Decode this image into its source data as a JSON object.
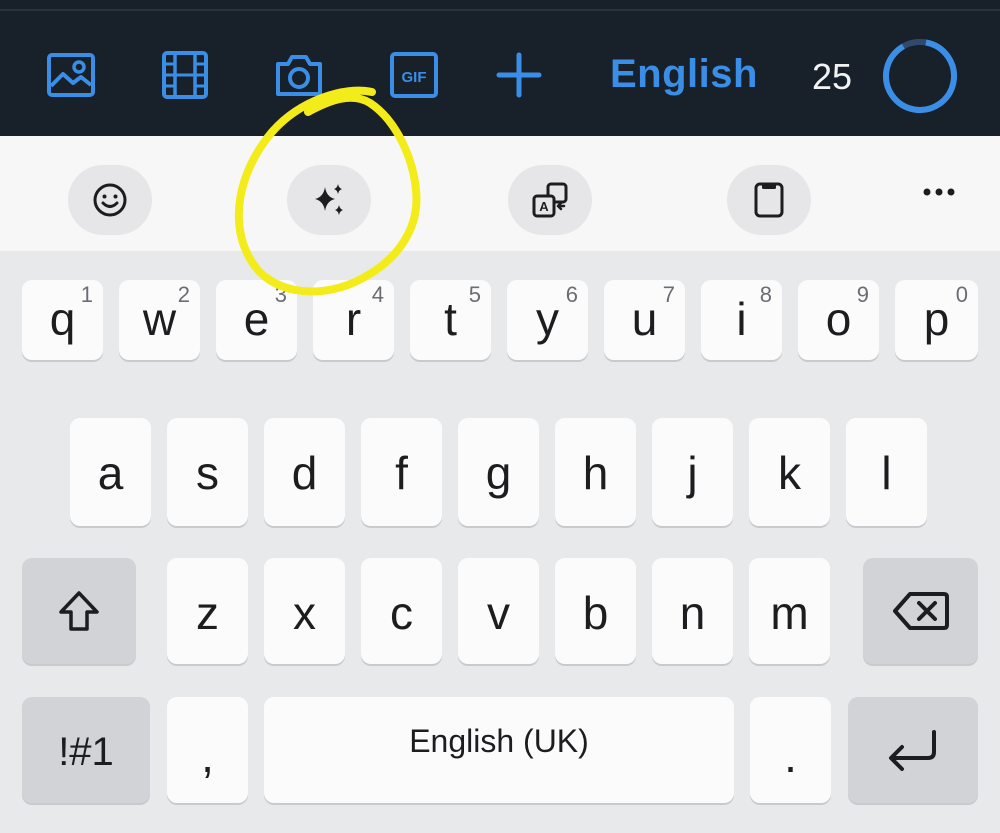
{
  "top_bar": {
    "icons": [
      "image-icon",
      "film-icon",
      "camera-icon",
      "gif-icon",
      "plus-icon"
    ],
    "gif_label": "GIF",
    "language_label": "English",
    "char_count": "25",
    "accent_color": "#3a8ee6"
  },
  "toolbar": {
    "icons": [
      "emoji-icon",
      "sparkles-icon",
      "translate-icon",
      "clipboard-icon",
      "more-dots-icon"
    ],
    "translate_letter": "A",
    "more_label": "···"
  },
  "keyboard": {
    "row1": [
      {
        "char": "q",
        "num": "1"
      },
      {
        "char": "w",
        "num": "2"
      },
      {
        "char": "e",
        "num": "3"
      },
      {
        "char": "r",
        "num": "4"
      },
      {
        "char": "t",
        "num": "5"
      },
      {
        "char": "y",
        "num": "6"
      },
      {
        "char": "u",
        "num": "7"
      },
      {
        "char": "i",
        "num": "8"
      },
      {
        "char": "o",
        "num": "9"
      },
      {
        "char": "p",
        "num": "0"
      }
    ],
    "row2": [
      "a",
      "s",
      "d",
      "f",
      "g",
      "h",
      "j",
      "k",
      "l"
    ],
    "row3": [
      "z",
      "x",
      "c",
      "v",
      "b",
      "n",
      "m"
    ],
    "symbols_label": "!#1",
    "comma_label": ",",
    "space_label": "English (UK)",
    "period_label": ".",
    "function_icons": [
      "shift-icon",
      "backspace-icon",
      "enter-icon"
    ]
  },
  "annotation": {
    "color": "#f4ec1a"
  }
}
